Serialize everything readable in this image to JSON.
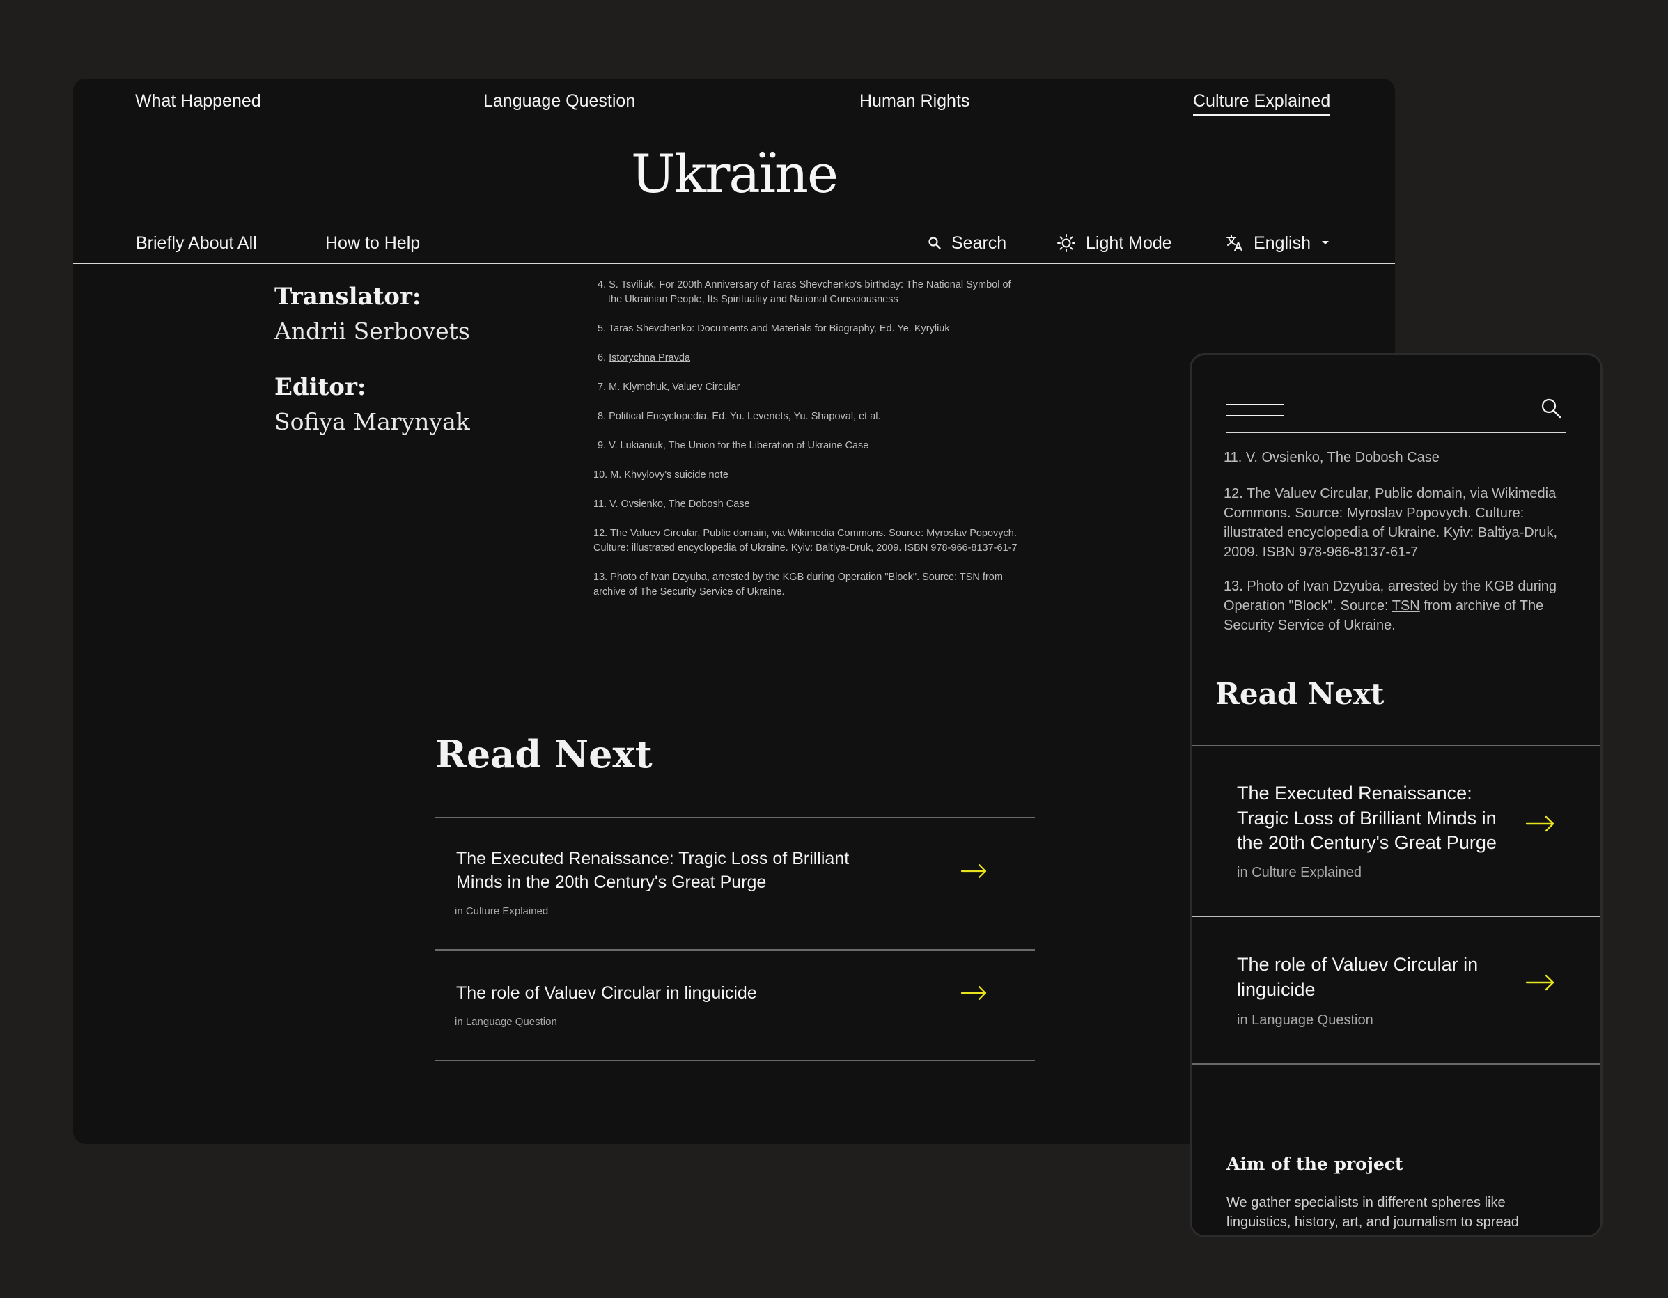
{
  "desktop": {
    "top_nav": [
      "What Happened",
      "Language Question",
      "Human Rights",
      "Culture Explained"
    ],
    "logo": "Ukraїne",
    "sub_nav": {
      "left": [
        "Briefly About All",
        "How to Help"
      ],
      "search": "Search",
      "light_mode": "Light Mode",
      "language": "English"
    },
    "credits": {
      "translator_label": "Translator:",
      "translator_name": "Andrii Serbovets",
      "editor_label": "Editor:",
      "editor_name": "Sofiya Marynyak"
    },
    "references": {
      "r4a": "4. S. Tsviliuk, For 200th Anniversary of Taras Shevchenko's birthday: The National Symbol of",
      "r4b": "the Ukrainian People, Its Spirituality and National Consciousness",
      "r5": "5. Taras Shevchenko: Documents and Materials for Biography, Ed. Ye. Kyryliuk",
      "r6_num": "6.",
      "r6_link": "Istorychna Pravda",
      "r7": "7. M. Klymchuk, Valuev Circular",
      "r8": "8. Political Encyclopedia, Ed. Yu. Levenets, Yu. Shapoval, et al.",
      "r9": "9. V. Lukianiuk, The Union for the Liberation of Ukraine Case",
      "r10": "10. M. Khvylovy's suicide note",
      "r11": "11. V. Ovsienko, The Dobosh Case",
      "r12": "12. The Valuev Circular, Public domain, via Wikimedia Commons. Source: Myroslav Popovych. Culture: illustrated encyclopedia of Ukraine. Kyiv: Baltiya-Druk, 2009. ISBN 978-966-8137-61-7",
      "r13_pre": "13. Photo of Ivan Dzyuba, arrested by the KGB during Operation \"Block\". Source: ",
      "r13_link": "TSN",
      "r13_post": " from archive of The Security Service of Ukraine."
    },
    "read_next": {
      "title": "Read Next",
      "items": [
        {
          "title": "The Executed Renaissance: Tragic Loss of Brilliant Minds in the 20th Century's Great Purge",
          "meta": "in Culture Explained"
        },
        {
          "title": "The role of Valuev Circular in linguicide",
          "meta": "in Language Question"
        }
      ]
    }
  },
  "mobile": {
    "references": {
      "r11": "11. V. Ovsienko, The Dobosh Case",
      "r12": "12. The Valuev Circular, Public domain, via Wikimedia Commons. Source: Myroslav Popovych. Culture: illustrated encyclopedia of Ukraine. Kyiv: Baltiya-Druk, 2009. ISBN 978-966-8137-61-7",
      "r13_pre": "13. Photo of Ivan Dzyuba, arrested by the KGB during Operation \"Block\". Source: ",
      "r13_link": "TSN",
      "r13_post": " from archive of The Security Service of Ukraine."
    },
    "read_next": {
      "title": "Read Next",
      "items": [
        {
          "title": "The Executed Renaissance: Tragic Loss of Brilliant Minds in the 20th Century's Great Purge",
          "meta": "in Culture Explained"
        },
        {
          "title": "The role of Valuev Circular in linguicide",
          "meta": "in Language Question"
        }
      ]
    },
    "aim": {
      "title": "Aim of the project",
      "body": "We gather specialists in different spheres like linguistics, history, art, and journalism to spread"
    }
  },
  "colors": {
    "background": "#1f1e1d",
    "panel": "#111111",
    "accent_arrow": "#e8e21f"
  },
  "icons": [
    "search-icon",
    "sun-icon",
    "translate-icon",
    "caret-down-icon",
    "arrow-right-icon",
    "hamburger-icon"
  ]
}
